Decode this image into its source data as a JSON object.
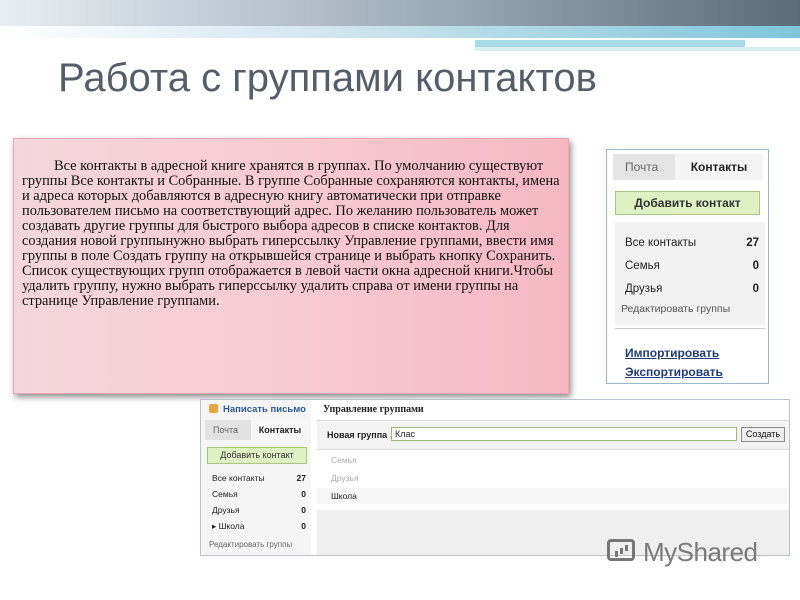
{
  "slide": {
    "title": "Работа с группами контактов",
    "body": "Все контакты в адресной книге хранятся в группах. По умолчанию существуют группы Все контакты и Собранные. В группе Собранные сохраняются контакты, имена и адреса которых добавляются в адресную книгу автоматически при отправке пользователем письмо на соответствующий адрес. По желанию пользователь может создавать другие группы для быстрого выбора адресов в списке контактов. Для создания новой группынужно выбрать гиперссылку Управление группами, ввести имя группы в поле Создать группу на открывшейся странице и выбрать кнопку Сохранить. Список существующих групп отображается в левой части окна адресной книги.Чтобы удалить группу, нужно выбрать гиперссылку удалить справа от имени группы на странице Управление группами."
  },
  "contacts_panel": {
    "tab_mail": "Почта",
    "tab_contacts": "Контакты",
    "add_contact": "Добавить контакт",
    "groups": [
      {
        "name": "Все контакты",
        "count": "27"
      },
      {
        "name": "Семья",
        "count": "0"
      },
      {
        "name": "Друзья",
        "count": "0"
      }
    ],
    "edit_groups": "Редактировать группы",
    "import": "Импортировать",
    "export": "Экспортировать"
  },
  "manage_window": {
    "write_letter": "Написать письмо",
    "tab_mail": "Почта",
    "tab_contacts": "Контакты",
    "add_contact": "Добавить контакт",
    "groups": [
      {
        "name": "Все контакты",
        "count": "27"
      },
      {
        "name": "Семья",
        "count": "0"
      },
      {
        "name": "Друзья",
        "count": "0"
      },
      {
        "name": "▸ Школа",
        "count": "0"
      }
    ],
    "edit_groups": "Редактировать группы",
    "heading": "Управление группами",
    "new_group_label": "Новая группа",
    "new_group_value": "Клас",
    "create_button": "Создать",
    "existing_groups": [
      "Семья",
      "Друзья",
      "Школа"
    ]
  },
  "watermark": {
    "text": "MyShared"
  },
  "colors": {
    "accent_green": "#dff0c3",
    "link_blue": "#1f3b7a",
    "box_pink": "#f8c9d1"
  }
}
